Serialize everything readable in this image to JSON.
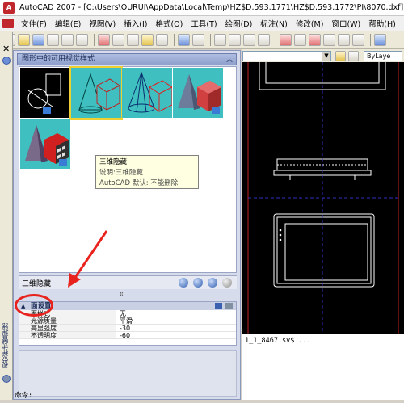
{
  "window": {
    "title": "AutoCAD 2007 - [C:\\Users\\OURUI\\AppData\\Local\\Temp\\HZ$D.593.1771\\HZ$D.593.1772\\PI\\8070.dxf]"
  },
  "menu": [
    {
      "label": "文件(F)"
    },
    {
      "label": "编辑(E)"
    },
    {
      "label": "视图(V)"
    },
    {
      "label": "插入(I)"
    },
    {
      "label": "格式(O)"
    },
    {
      "label": "工具(T)"
    },
    {
      "label": "绘图(D)"
    },
    {
      "label": "标注(N)"
    },
    {
      "label": "修改(M)"
    },
    {
      "label": "窗口(W)"
    },
    {
      "label": "帮助(H)"
    }
  ],
  "toolbar": {
    "layer_combo": "ByLaye"
  },
  "palette": {
    "vertical_title": "视觉样式管理器",
    "header": "图形中的可用视觉样式",
    "swatches": [
      {
        "icon": "2d-wireframe-icon"
      },
      {
        "icon": "3d-hidden-icon"
      },
      {
        "icon": "3d-wireframe-icon"
      },
      {
        "icon": "conceptual-icon"
      },
      {
        "icon": "realistic-icon"
      }
    ],
    "tooltip": {
      "title": "三维隐藏",
      "description": "说明:三维隐藏",
      "default_note": "AutoCAD 默认: 不能删除"
    },
    "current_style": "三维隐藏",
    "properties": {
      "section": "面设置",
      "rows": [
        {
          "name": "面样式",
          "value": "无"
        },
        {
          "name": "光源质量",
          "value": "平滑"
        },
        {
          "name": "亮显强度",
          "value": "-30"
        },
        {
          "name": "不透明度",
          "value": "-60"
        }
      ]
    }
  },
  "command": {
    "history_line": "1_1_8467.sv$ ...",
    "prompt": "命令:"
  },
  "colors": {
    "accent_red": "#e8221c",
    "palette_bg": "#d6dcec",
    "drawing_bg": "#000000"
  }
}
